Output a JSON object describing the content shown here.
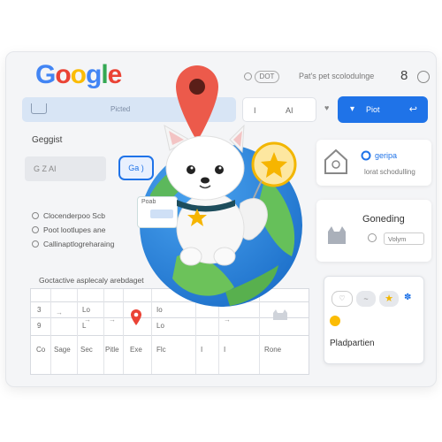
{
  "header": {
    "logo": [
      "G",
      "o",
      "o",
      "g",
      "l",
      "e"
    ],
    "logo_colors": [
      "#4285F4",
      "#EA4335",
      "#FBBC05",
      "#4285F4",
      "#34A853",
      "#EA4335"
    ],
    "pill_text": "DOT",
    "right_text": "Pat's pet scolodulnge",
    "count": "8"
  },
  "toolbar": {
    "search_text": "Picted",
    "mid_a": "I",
    "mid_b": "AI",
    "button_label": "Piot"
  },
  "left": {
    "section_title": "Geggist",
    "input_text": "G    Z AI",
    "small_button": "Ga )",
    "radio_items": [
      "Clocenderpoo Scb",
      "Poot lootlupes ane",
      "Callinaptlogreharaing"
    ]
  },
  "table": {
    "caption": "Goctactive asplecaly arebdaget",
    "rows": [
      [
        "3",
        "Lo",
        "Io"
      ],
      [
        "9",
        "L",
        "Lo"
      ]
    ],
    "footer": [
      "Co",
      "Sage",
      "Sec",
      "Pitle",
      "Exe",
      "Flc",
      "I",
      "I",
      "Rone"
    ]
  },
  "right": {
    "card1_title": "geripa",
    "card1_sub": "lorat schodulling",
    "card2_title": "Goneding",
    "card2_sub": "Volym",
    "card3_title": "Pladpartien"
  },
  "illustration": {
    "tag_text": "Poab"
  }
}
